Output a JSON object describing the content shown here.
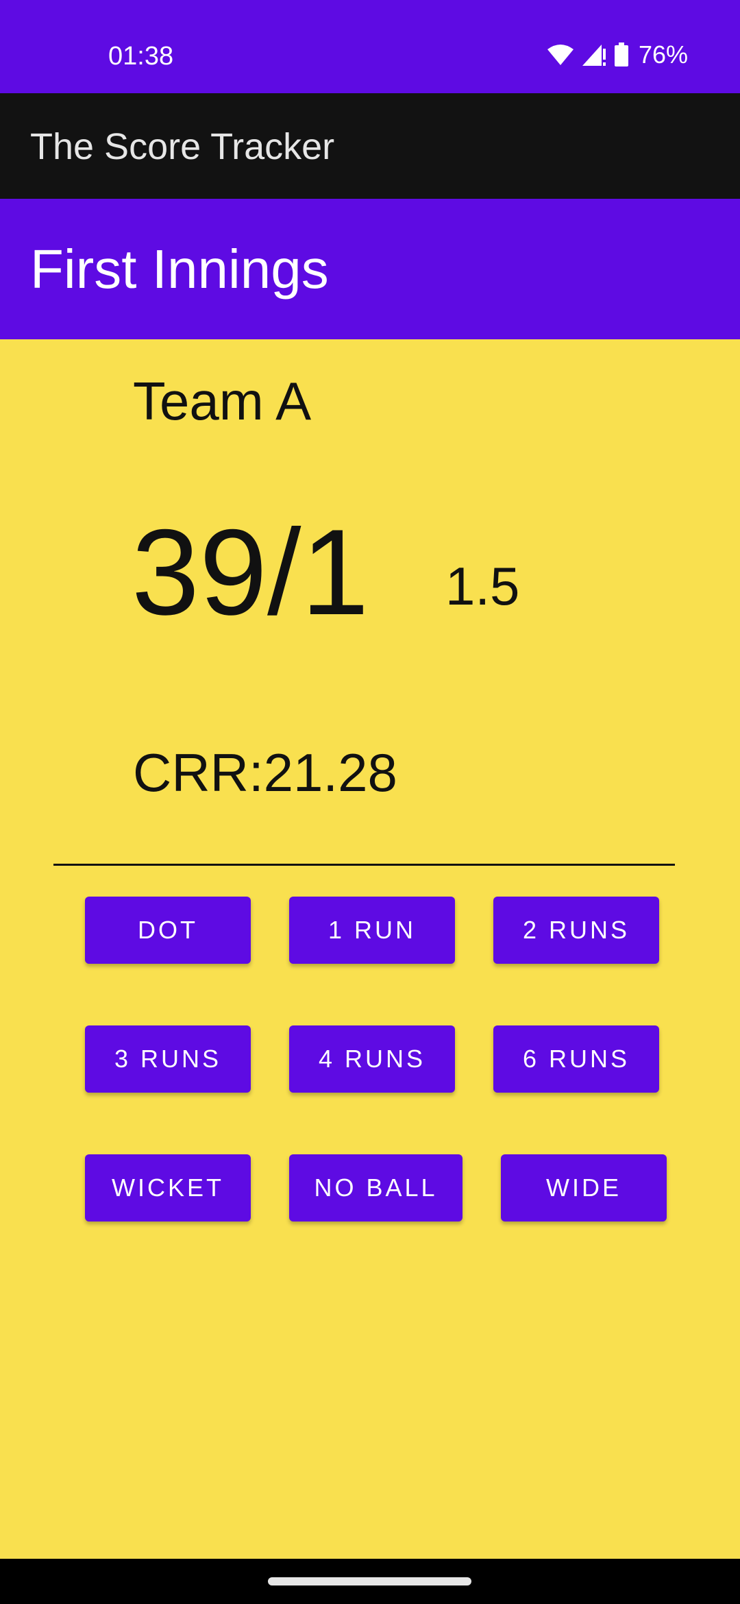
{
  "status_bar": {
    "time": "01:38",
    "battery_percent": "76%",
    "icons": [
      "wifi-icon",
      "cell-signal-icon",
      "battery-icon"
    ]
  },
  "app_bar": {
    "title": "The Score Tracker"
  },
  "innings": {
    "title": "First Innings"
  },
  "scoreboard": {
    "team": "Team A",
    "score": "39/1",
    "overs": "1.5",
    "crr": "CRR:21.28"
  },
  "buttons": {
    "dot": "DOT",
    "one_run": "1 RUN",
    "two_runs": "2 RUNS",
    "three_runs": "3 RUNS",
    "four_runs": "4 RUNS",
    "six_runs": "6 RUNS",
    "wicket": "WICKET",
    "no_ball": "NO BALL",
    "wide": "WIDE"
  },
  "colors": {
    "primary": "#5E0BE3",
    "background": "#F9E04F",
    "app_bar": "#121212",
    "text": "#111111"
  }
}
